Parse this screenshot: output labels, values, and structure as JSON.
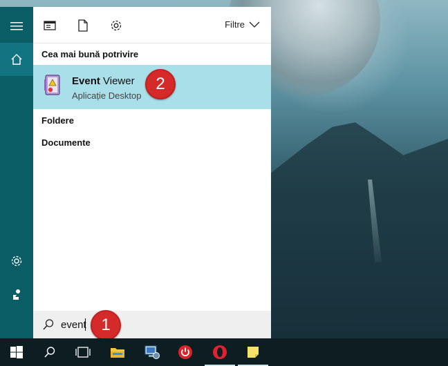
{
  "search": {
    "query": "event",
    "results_header": "Cea mai bună potrivire",
    "best_match": {
      "name_bold": "Event",
      "name_rest": " Viewer",
      "subtitle": "Aplicație Desktop"
    },
    "sections": [
      "Foldere",
      "Documente"
    ]
  },
  "topbar": {
    "filter_label": "Filtre"
  },
  "callouts": {
    "one": "1",
    "two": "2"
  },
  "rail": {
    "items": [
      "menu-icon",
      "home-icon",
      "settings-icon",
      "feedback-icon"
    ]
  },
  "taskbar": {
    "items": [
      "windows-start-icon",
      "search-icon",
      "task-view-icon",
      "file-explorer-icon",
      "network-app-icon",
      "power-app-icon",
      "opera-icon",
      "sticky-notes-icon"
    ]
  },
  "colors": {
    "rail_bg": "#0a5c65",
    "highlight": "#a8dfe8",
    "callout": "#d42a2a",
    "taskbar_bg": "#0e1d22"
  }
}
